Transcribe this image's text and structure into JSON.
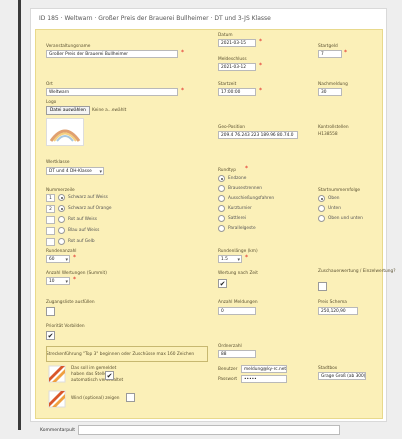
{
  "page": {
    "title": "ID 185 · Weltwarn · Großer Preis der Brauerei Bullheimer · DT und 3-JS Klasse"
  },
  "form": {
    "veranstaltung_label": "Veranstaltungsname",
    "veranstaltung_value": "Großer Preis der Brauerei Bullheimer",
    "datum_label": "Datum",
    "datum_value": "2021-03-15",
    "startgeld_label": "Startgeld",
    "startgeld_value": "7",
    "meldeschluss_label": "Meldeschluss",
    "meldeschluss_value": "2021-03-12",
    "ort_label": "Ort",
    "ort_value": "Weltwarn",
    "startzeit_label": "Startzeit",
    "startzeit_value": "17:00:00",
    "nachmeldung_label": "Nachmeldung",
    "nachmeldung_value": "30",
    "logo_label": "Logo",
    "file_button": "Datei auswählen",
    "file_name": "Keine a...ewählt",
    "geo_label": "Geo-Position",
    "geo_value": "209.4 76.243 223 189.96 80.74.0",
    "kontrollstellen_label": "Kontrollstellen",
    "kontrollstellen_value": "H138558",
    "wertung_label": "Wertklasse",
    "wertung_value": "DT und 4 DH-Klasse",
    "runde_label": "Rundtyp",
    "runde_options": [
      "Endzone",
      "Brausestrennen",
      "Ausschießungsfahren",
      "Kurzturnier",
      "Sattlerei",
      "Parallelgeste"
    ],
    "runde_selected": 0,
    "bonus_label": "Nummerzeile",
    "bonus_rows": [
      {
        "num": "1",
        "label": "Schwarz auf Weiss",
        "selected": true
      },
      {
        "num": "2",
        "label": "Schwarz auf Orange",
        "selected": true
      },
      {
        "num": "",
        "label": "Rot auf Weiss",
        "selected": false
      },
      {
        "num": "",
        "label": "Blau auf Weiss",
        "selected": false
      },
      {
        "num": "",
        "label": "Rot auf Gelb",
        "selected": false
      }
    ],
    "sort_label": "Startnummernfolge",
    "sort_options": [
      "Oben",
      "Unten",
      "Oben und unten"
    ],
    "sort_selected": 0,
    "rundenanzahl_label": "Rundenanzahl",
    "rundenanzahl_value": "60",
    "rundenlaenge_label": "Rundenlänge (km)",
    "rundenlaenge_value": "1.5",
    "anzahl_wertungen_label": "Anzahl Wertungen (Summit)",
    "anzahl_wertungen_value": "10",
    "wertung_zeit_label": "Wertung nach Zeit",
    "wertung_zeit_checked": true,
    "zuschauer_label": "Zuschauerwertung / Einzelwertung?",
    "zugangsliste_label": "Zugangsliste ausfüllen",
    "anzahl_meldungen_label": "Anzahl Meldungen",
    "anzahl_meldungen_value": "0",
    "preis_label": "Preis Schema",
    "preis_value": "250,120,90",
    "prior_label": "Priorität Vorbilden",
    "prior_checked": true,
    "seitentext_label": "Streckenführung \"Top 3\" beginnen oder Zuschüsse max 160 Zeichen",
    "ordner_label": "Ordnerzahl",
    "ordner_value": "88",
    "auto_text": "Das soll im gemeldet haben das Stellen automatisch verschaltet",
    "auto_checked": true,
    "benutzer_label": "Benutzer",
    "benutzer_value": "meldung@ky-rc.net",
    "passwort_label": "Passwort",
    "passwort_value": "•••••",
    "stadtbox_label": "Stadtbox",
    "stadtbox_value": "Grage Groß (ab 300)",
    "wind_text": "Wind (optional) zeigen",
    "wind_checked": false
  },
  "footer": {
    "kommentar_label": "Kommentarpult"
  },
  "colors": {
    "form_bg": "#fbf0b8",
    "required": "#e02020"
  }
}
